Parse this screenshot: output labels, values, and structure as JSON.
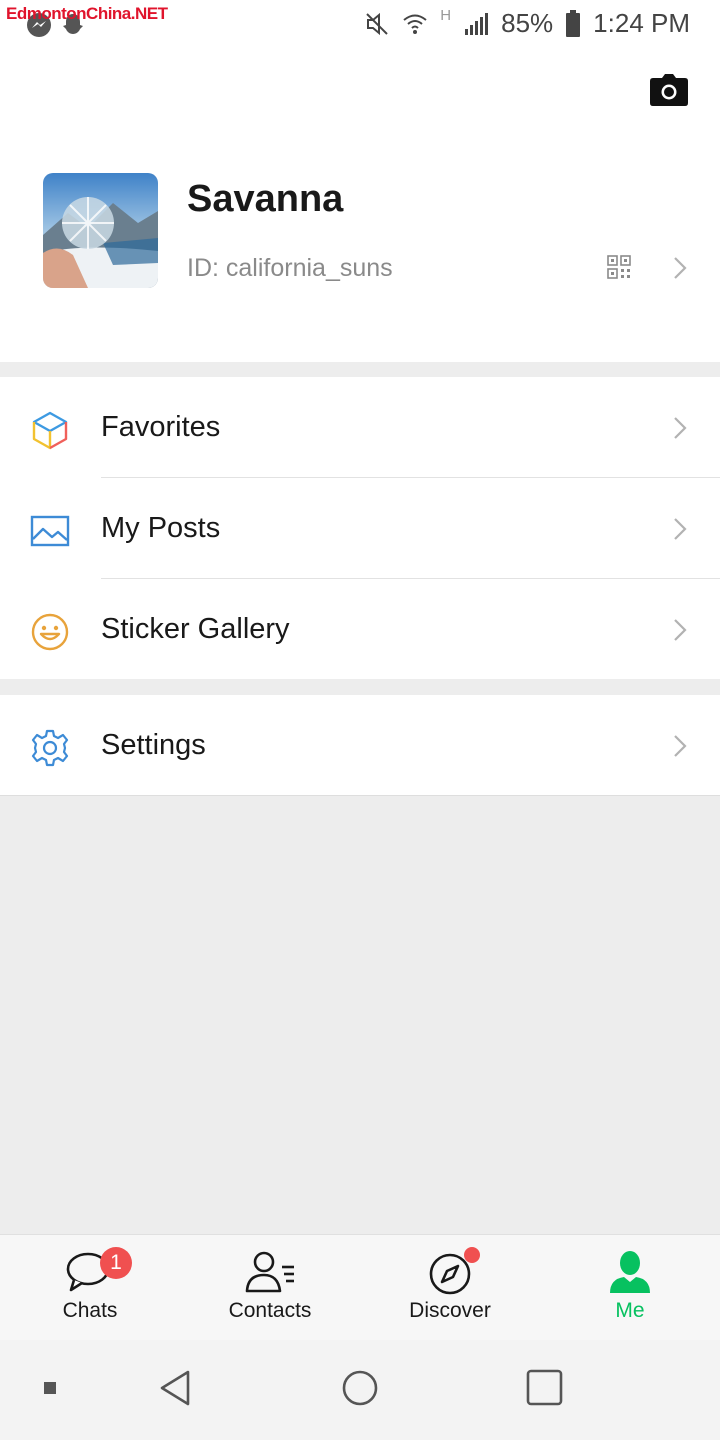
{
  "status_bar": {
    "watermark": "EdmontonChina.NET",
    "battery": "85%",
    "time": "1:24 PM",
    "network": "H"
  },
  "header": {
    "camera_icon": "camera-icon"
  },
  "profile": {
    "name": "Savanna",
    "id": "ID: california_suns"
  },
  "menu": {
    "items": [
      {
        "label": "Favorites",
        "icon": "cube-icon"
      },
      {
        "label": "My Posts",
        "icon": "image-icon"
      },
      {
        "label": "Sticker Gallery",
        "icon": "smiley-icon"
      }
    ],
    "settings": {
      "label": "Settings",
      "icon": "gear-icon"
    }
  },
  "tabs": [
    {
      "label": "Chats",
      "badge": "1"
    },
    {
      "label": "Contacts"
    },
    {
      "label": "Discover"
    },
    {
      "label": "Me"
    }
  ],
  "colors": {
    "accent": "#07c160",
    "badge": "#f05050",
    "background": "#ededed"
  }
}
